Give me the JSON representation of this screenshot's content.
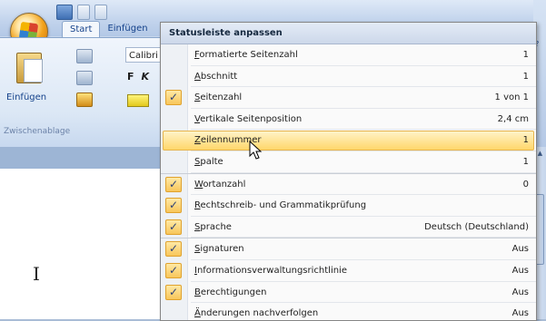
{
  "window": {
    "tabs": [
      {
        "label": "Start",
        "active": true
      },
      {
        "label": "Einfügen",
        "active": false
      }
    ],
    "ribbon": {
      "paste_label": "Einfügen",
      "clipboard_group_label": "Zwischenablage",
      "font_name": "Calibri",
      "format_buttons": [
        "F",
        "K"
      ]
    },
    "document_text": "I"
  },
  "menu": {
    "title": "Statusleiste anpassen",
    "items": [
      {
        "label": "Formatierte Seitenzahl",
        "value": "1",
        "checked": false
      },
      {
        "label": "Abschnitt",
        "value": "1",
        "checked": false
      },
      {
        "label": "Seitenzahl",
        "value": "1 von 1",
        "checked": true
      },
      {
        "label": "Vertikale Seitenposition",
        "value": "2,4 cm",
        "checked": false
      },
      {
        "label": "Zeilennummer",
        "value": "1",
        "checked": false,
        "hover": true
      },
      {
        "label": "Spalte",
        "value": "1",
        "checked": false
      },
      {
        "label": "Wortanzahl",
        "value": "0",
        "checked": true
      },
      {
        "label": "Rechtschreib- und Grammatikprüfung",
        "value": "",
        "checked": true
      },
      {
        "label": "Sprache",
        "value": "Deutsch (Deutschland)",
        "checked": true
      },
      {
        "label": "Signaturen",
        "value": "Aus",
        "checked": true
      },
      {
        "label": "Informationsverwaltungsrichtlinie",
        "value": "Aus",
        "checked": true
      },
      {
        "label": "Berechtigungen",
        "value": "Aus",
        "checked": true
      },
      {
        "label": "Änderungen nachverfolgen",
        "value": "Aus",
        "checked": false
      }
    ]
  },
  "colors": {
    "check_bg": "#f8c65b",
    "hover_bg": "#ffd76b",
    "ribbon_text": "#15428b"
  }
}
